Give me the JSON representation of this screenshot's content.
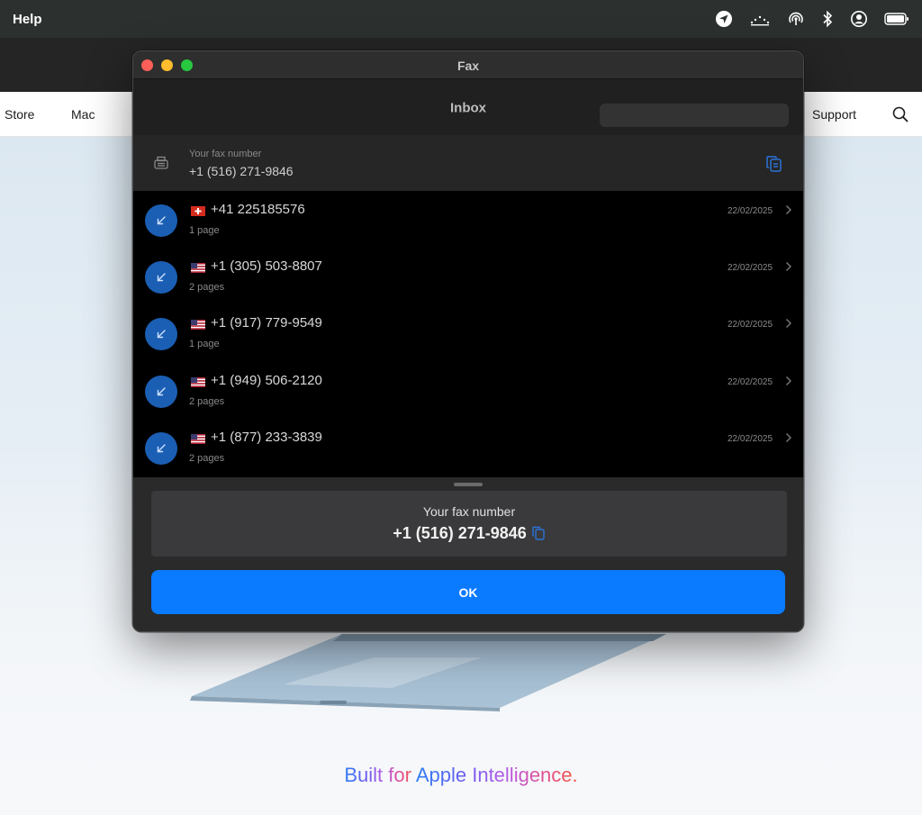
{
  "menubar": {
    "menu_title": "Help",
    "status_icons": [
      "location-icon",
      "activity-icon",
      "airdrop-icon",
      "bluetooth-icon",
      "user-account-icon",
      "battery-icon"
    ]
  },
  "webpage": {
    "nav": {
      "store": "Store",
      "mac": "Mac",
      "support": "Support"
    },
    "tagline": {
      "prefix": "Built for ",
      "highlight": "Apple Intelligence."
    }
  },
  "window": {
    "title": "Fax",
    "toolbar": {
      "title": "Inbox",
      "search_placeholder": ""
    },
    "fax_number_row": {
      "label": "Your fax number",
      "number": "+1 (516) 271-9846"
    },
    "faxes": [
      {
        "flag": "ch",
        "number": "+41 225185576",
        "pages": "1 page",
        "date": "22/02/2025"
      },
      {
        "flag": "us",
        "number": "+1 (305) 503-8807",
        "pages": "2 pages",
        "date": "22/02/2025"
      },
      {
        "flag": "us",
        "number": "+1 (917) 779-9549",
        "pages": "1 page",
        "date": "22/02/2025"
      },
      {
        "flag": "us",
        "number": "+1 (949) 506-2120",
        "pages": "2 pages",
        "date": "22/02/2025"
      },
      {
        "flag": "us",
        "number": "+1 (877) 233-3839",
        "pages": "2 pages",
        "date": "22/02/2025"
      }
    ],
    "sheet": {
      "label": "Your fax number",
      "number": "+1 (516) 271-9846",
      "ok_label": "OK"
    }
  },
  "colors": {
    "accent": "#0a7aff",
    "avatar": "#1b5fb4",
    "menubar": "#2c3130"
  }
}
